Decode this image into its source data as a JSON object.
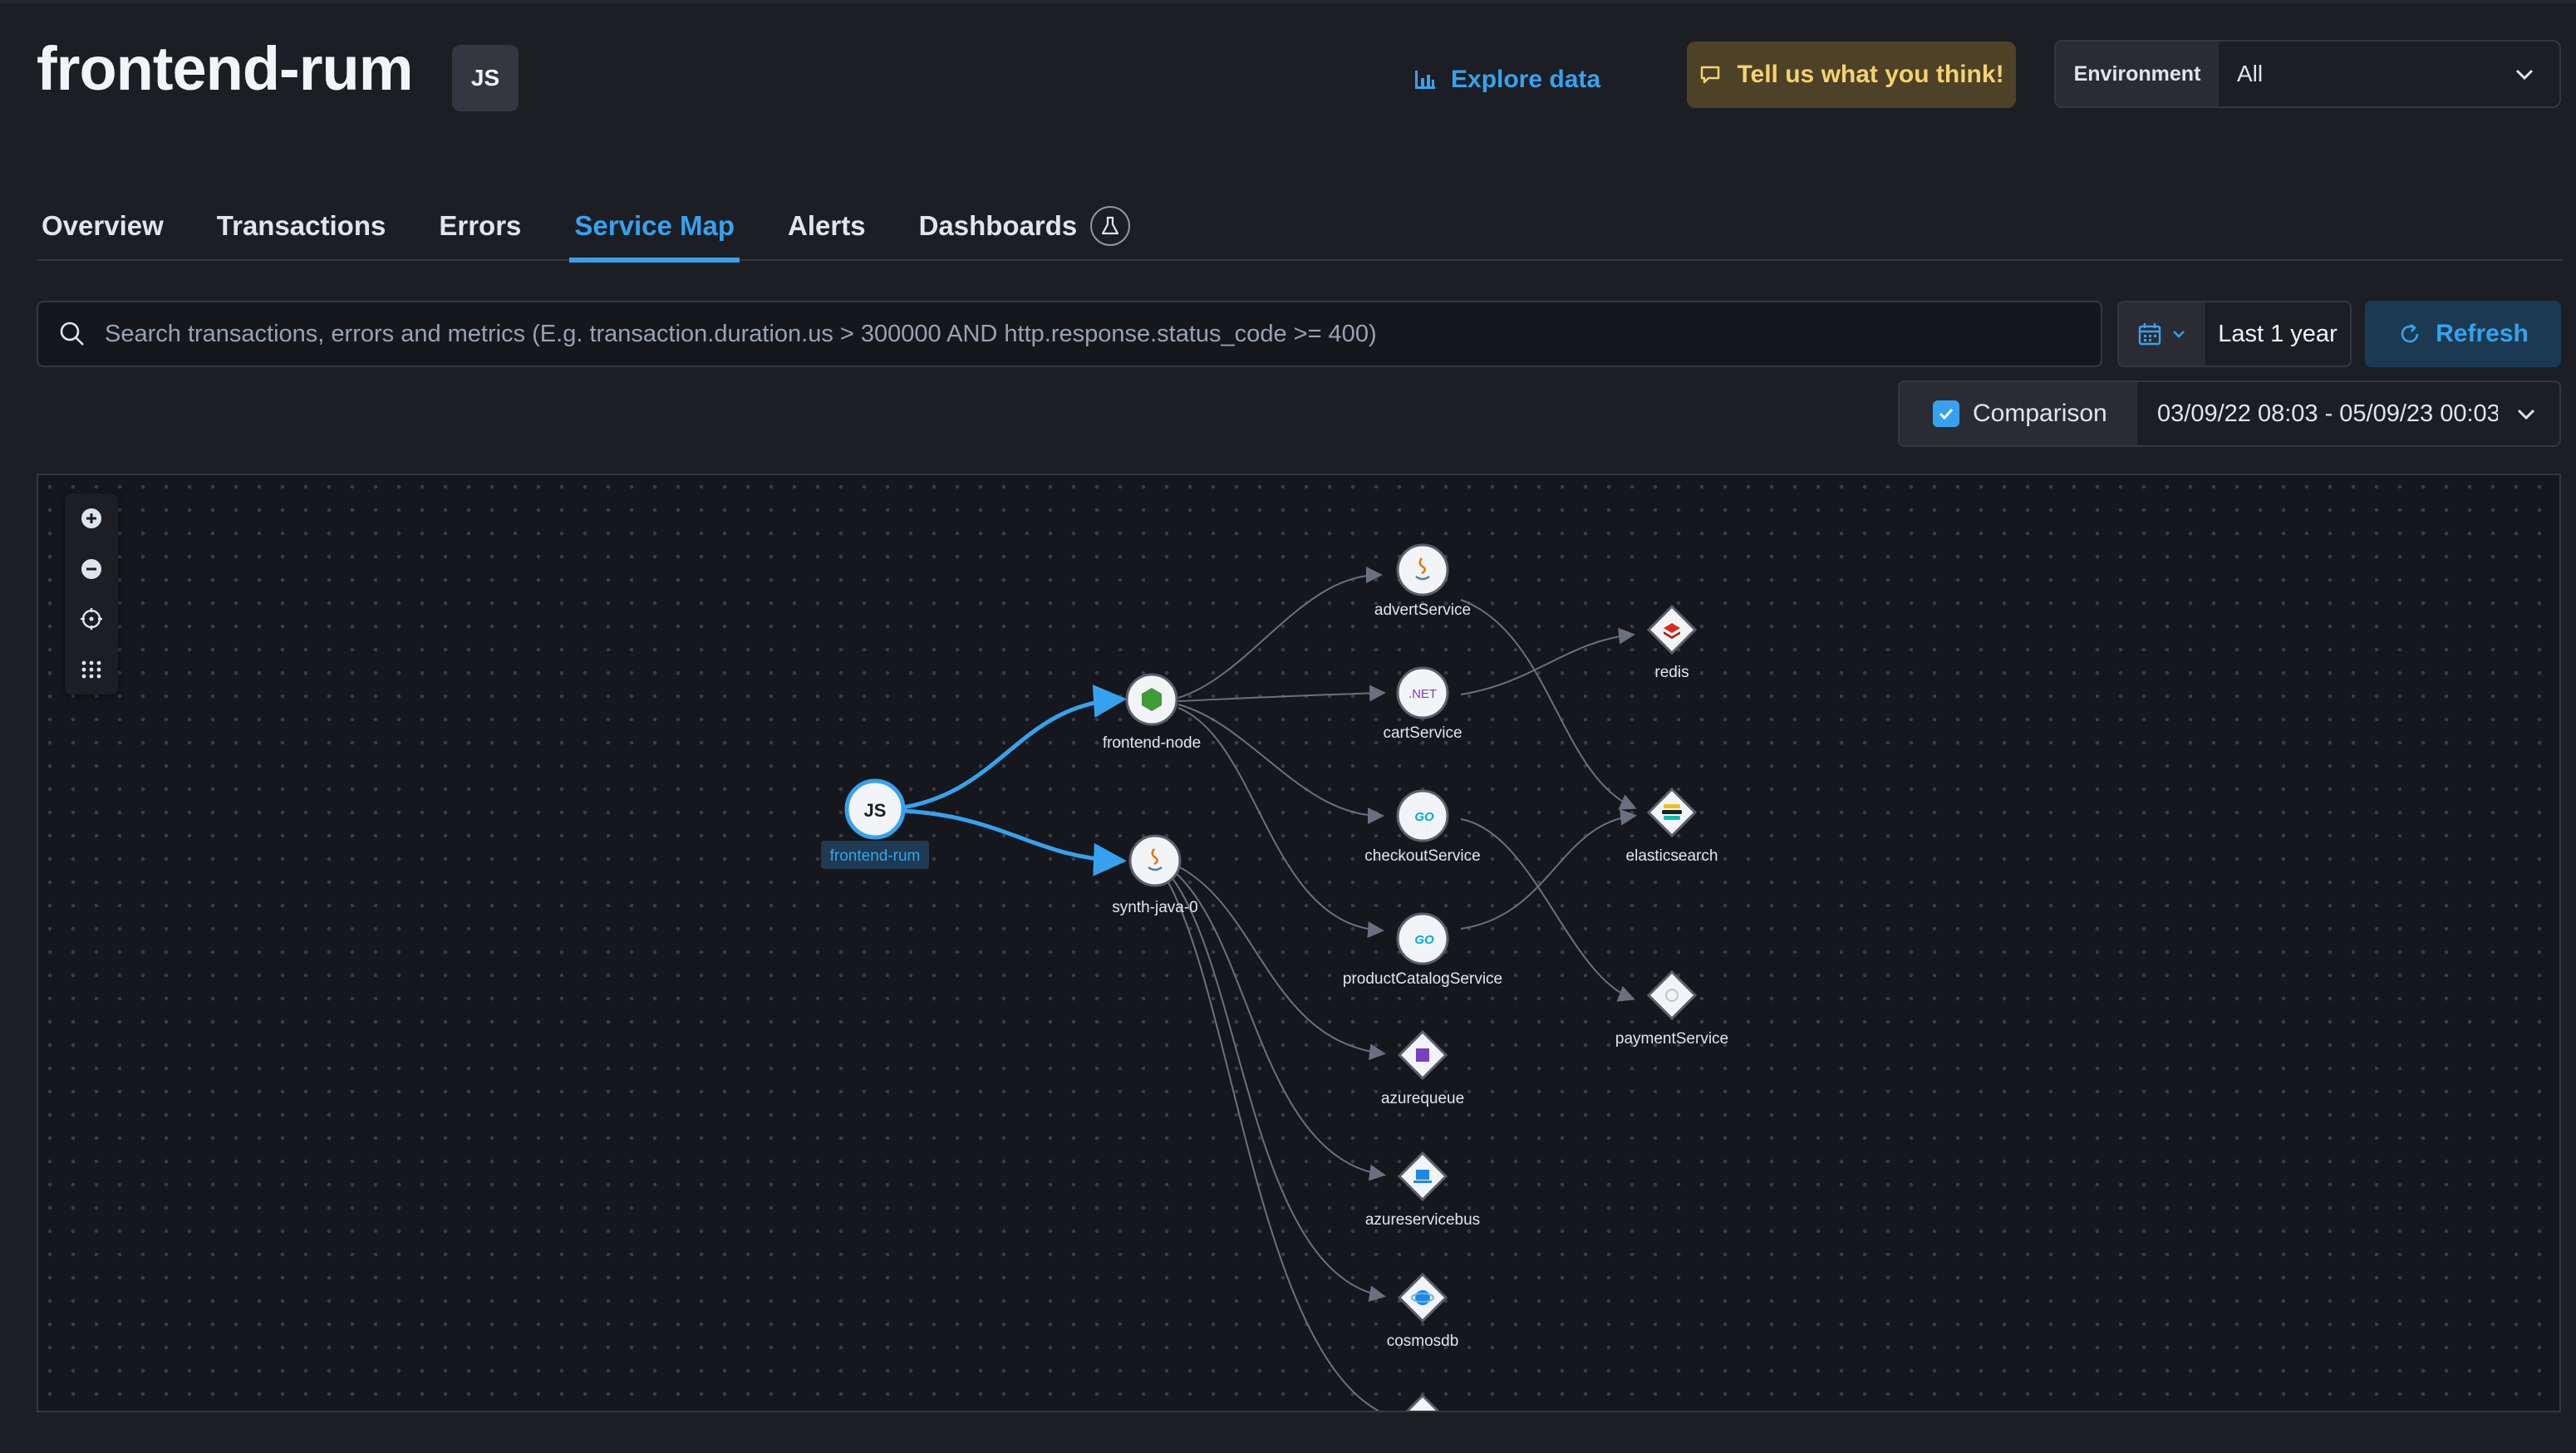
{
  "header": {
    "title": "frontend-rum",
    "agent_badge": "JS",
    "explore_label": "Explore data",
    "feedback_label": "Tell us what you think!",
    "environment_label": "Environment",
    "environment_value": "All"
  },
  "tabs": [
    {
      "label": "Overview"
    },
    {
      "label": "Transactions"
    },
    {
      "label": "Errors"
    },
    {
      "label": "Service Map",
      "active": true
    },
    {
      "label": "Alerts"
    },
    {
      "label": "Dashboards"
    }
  ],
  "search": {
    "placeholder": "Search transactions, errors and metrics (E.g. transaction.duration.us > 300000 AND http.response.status_code >= 400)"
  },
  "date": {
    "range_label": "Last 1 year",
    "refresh_label": "Refresh"
  },
  "comparison": {
    "label": "Comparison",
    "checked": true,
    "range": "03/09/22 08:03 - 05/09/23 00:03"
  },
  "colors": {
    "accent": "#36a2ef",
    "edge": "#6a7080"
  },
  "service_map": {
    "nodes": {
      "frontend_rum": {
        "label": "frontend-rum",
        "icon": "JS"
      },
      "frontend_node": {
        "label": "frontend-node",
        "icon": "nodejs-icon"
      },
      "synth_java": {
        "label": "synth-java-0",
        "icon": "java-icon"
      },
      "advert": {
        "label": "advertService",
        "icon": "java-icon"
      },
      "cart": {
        "label": "cartService",
        "icon": ".NET"
      },
      "checkout": {
        "label": "checkoutService",
        "icon": "GO"
      },
      "product": {
        "label": "productCatalogService",
        "icon": "GO"
      },
      "azurequeue": {
        "label": "azurequeue",
        "icon": "azure-queue-icon"
      },
      "servicebus": {
        "label": "azureservicebus",
        "icon": "azure-servicebus-icon"
      },
      "cosmosdb": {
        "label": "cosmosdb",
        "icon": "cosmosdb-icon"
      },
      "redis": {
        "label": "redis",
        "icon": "redis-icon"
      },
      "elasticsearch": {
        "label": "elasticsearch",
        "icon": "elasticsearch-icon"
      },
      "payment": {
        "label": "paymentService",
        "icon": "payment-icon"
      }
    }
  }
}
